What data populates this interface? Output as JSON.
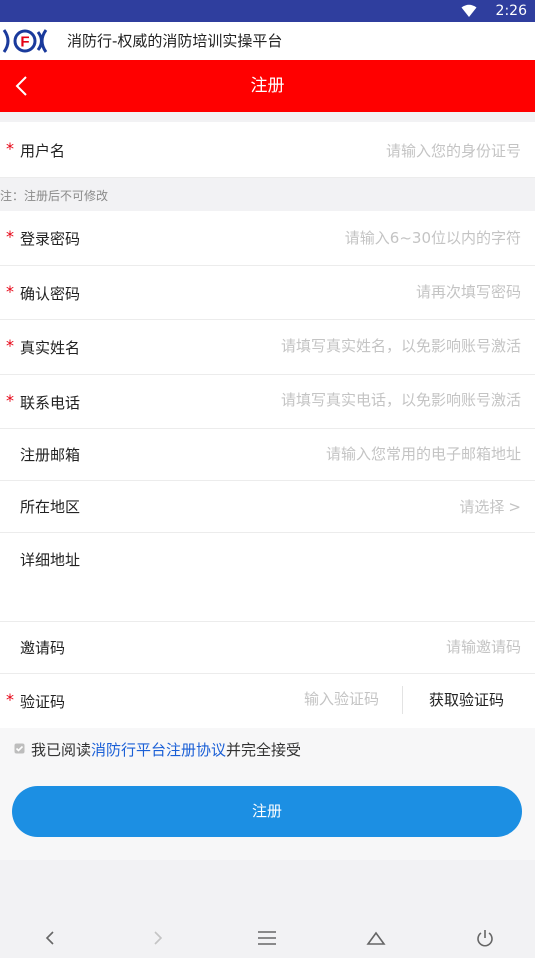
{
  "status": {
    "time": "2:26",
    "wifi_icon": "wifi-icon"
  },
  "app": {
    "logo_text": "XFX",
    "title": "消防行-权威的消防培训实操平台"
  },
  "nav": {
    "title": "注册",
    "back_icon": "chevron-left-icon",
    "bar_color": "#ff0000"
  },
  "form": {
    "username": {
      "required": "*",
      "label": "用户名",
      "placeholder": "请输入您的身份证号"
    },
    "note": "注：注册后不可修改",
    "password": {
      "required": "*",
      "label": "登录密码",
      "placeholder": "请输入6~30位以内的字符"
    },
    "confirm": {
      "required": "*",
      "label": "确认密码",
      "placeholder": "请再次填写密码"
    },
    "realname": {
      "required": "*",
      "label": "真实姓名",
      "placeholder": "请填写真实姓名，以免影响账号激活"
    },
    "phone": {
      "required": "*",
      "label": "联系电话",
      "placeholder": "请填写真实电话，以免影响账号激活"
    },
    "email": {
      "label": "注册邮箱",
      "placeholder": "请输入您常用的电子邮箱地址"
    },
    "region": {
      "label": "所在地区",
      "value": "请选择",
      "arrow": ">"
    },
    "address": {
      "label": "详细地址"
    },
    "invite": {
      "label": "邀请码",
      "placeholder": "请输邀请码"
    },
    "vcode": {
      "required": "*",
      "label": "验证码",
      "placeholder": "输入验证码",
      "button": "获取验证码"
    }
  },
  "agreement": {
    "prefix": "我已阅读",
    "link": "消防行平台注册协议",
    "suffix": "并完全接受",
    "checked": true
  },
  "submit_label": "注册",
  "colors": {
    "accent": "#1c8fe3",
    "required": "#e60012",
    "link": "#1a5fd6",
    "statusbar": "#2f3e9e"
  }
}
